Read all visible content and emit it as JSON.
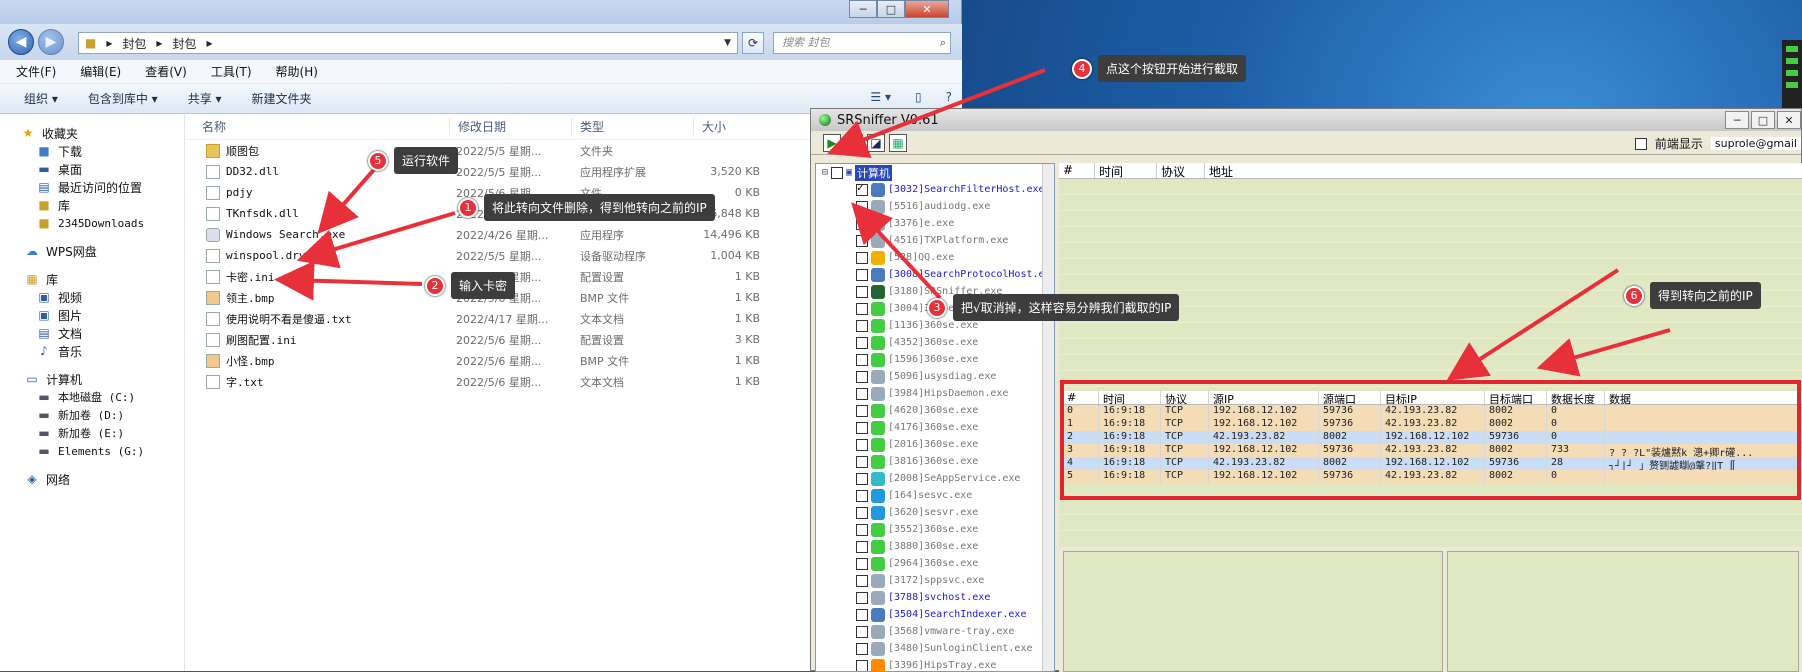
{
  "explorer": {
    "breadcrumb": [
      "封包",
      "封包"
    ],
    "search_placeholder": "搜索 封包",
    "menu": [
      "文件(F)",
      "编辑(E)",
      "查看(V)",
      "工具(T)",
      "帮助(H)"
    ],
    "toolbar": [
      "组织 ▾",
      "包含到库中 ▾",
      "共享 ▾",
      "新建文件夹"
    ],
    "nav": {
      "favorites": "收藏夹",
      "fav_items": [
        "下载",
        "桌面",
        "最近访问的位置",
        "库",
        "2345Downloads"
      ],
      "wps": "WPS网盘",
      "library": "库",
      "lib_items": [
        "视频",
        "图片",
        "文档",
        "音乐"
      ],
      "computer": "计算机",
      "drives": [
        "本地磁盘 (C:)",
        "新加卷 (D:)",
        "新加卷 (E:)",
        "Elements (G:)"
      ],
      "network": "网络"
    },
    "columns": [
      "名称",
      "修改日期",
      "类型",
      "大小"
    ],
    "files": [
      {
        "name": "顺图包",
        "date": "2022/5/5 星期...",
        "type": "文件夹",
        "size": "",
        "icon": "folder"
      },
      {
        "name": "DD32.dll",
        "date": "2022/5/5 星期...",
        "type": "应用程序扩展",
        "size": "3,520 KB",
        "icon": "file"
      },
      {
        "name": "pdjy",
        "date": "2022/5/6 星期...",
        "type": "文件",
        "size": "0 KB",
        "icon": "file"
      },
      {
        "name": "TKnfsdk.dll",
        "date": "2022/5/5 星期...",
        "type": "应用程序扩展",
        "size": "6,848 KB",
        "icon": "file"
      },
      {
        "name": "Windows Search.exe",
        "date": "2022/4/26 星期...",
        "type": "应用程序",
        "size": "14,496 KB",
        "icon": "exe"
      },
      {
        "name": "winspool.drv",
        "date": "2022/5/5 星期...",
        "type": "设备驱动程序",
        "size": "1,004 KB",
        "icon": "file"
      },
      {
        "name": "卡密.ini",
        "date": "2022/5/6 星期...",
        "type": "配置设置",
        "size": "1 KB",
        "icon": "file"
      },
      {
        "name": "领主.bmp",
        "date": "2022/5/6 星期...",
        "type": "BMP 文件",
        "size": "1 KB",
        "icon": "bmp"
      },
      {
        "name": "使用说明不看是傻逼.txt",
        "date": "2022/4/17 星期...",
        "type": "文本文档",
        "size": "1 KB",
        "icon": "file"
      },
      {
        "name": "刷图配置.ini",
        "date": "2022/5/6 星期...",
        "type": "配置设置",
        "size": "3 KB",
        "icon": "file"
      },
      {
        "name": "小怪.bmp",
        "date": "2022/5/6 星期...",
        "type": "BMP 文件",
        "size": "1 KB",
        "icon": "bmp"
      },
      {
        "name": "字.txt",
        "date": "2022/5/6 星期...",
        "type": "文本文档",
        "size": "1 KB",
        "icon": "file"
      }
    ]
  },
  "sniffer": {
    "title": "SRSniffer V0.61",
    "option_label": "前端显示",
    "user": "suprole@gmail",
    "tree_root": "计算机",
    "processes": [
      {
        "text": "[3032]SearchFilterHost.exe",
        "hl": true,
        "checked": true,
        "color": "#4a7bbf"
      },
      {
        "text": "[5516]audiodg.exe",
        "hl": false,
        "checked": false,
        "color": "#9ab"
      },
      {
        "text": "[3376]e.exe",
        "hl": false,
        "checked": false,
        "color": "#9ab"
      },
      {
        "text": "[4516]TXPlatform.exe",
        "hl": false,
        "checked": false,
        "color": "#9ab"
      },
      {
        "text": "[528]QQ.exe",
        "hl": false,
        "checked": false,
        "color": "#f0b000"
      },
      {
        "text": "[3008]SearchProtocolHost.e",
        "hl": true,
        "checked": false,
        "color": "#4a7bbf"
      },
      {
        "text": "[3180]SRSniffer.exe",
        "hl": false,
        "checked": false,
        "color": "#263"
      },
      {
        "text": "[3004]360se.exe",
        "hl": false,
        "checked": false,
        "color": "#4c4"
      },
      {
        "text": "[1136]360se.exe",
        "hl": false,
        "checked": false,
        "color": "#4c4"
      },
      {
        "text": "[4352]360se.exe",
        "hl": false,
        "checked": false,
        "color": "#4c4"
      },
      {
        "text": "[1596]360se.exe",
        "hl": false,
        "checked": false,
        "color": "#4c4"
      },
      {
        "text": "[5096]usysdiag.exe",
        "hl": false,
        "checked": false,
        "color": "#9ab"
      },
      {
        "text": "[3984]HipsDaemon.exe",
        "hl": false,
        "checked": false,
        "color": "#9ab"
      },
      {
        "text": "[4620]360se.exe",
        "hl": false,
        "checked": false,
        "color": "#4c4"
      },
      {
        "text": "[4176]360se.exe",
        "hl": false,
        "checked": false,
        "color": "#4c4"
      },
      {
        "text": "[2016]360se.exe",
        "hl": false,
        "checked": false,
        "color": "#4c4"
      },
      {
        "text": "[3816]360se.exe",
        "hl": false,
        "checked": false,
        "color": "#4c4"
      },
      {
        "text": "[2008]SeAppService.exe",
        "hl": false,
        "checked": false,
        "color": "#3bc"
      },
      {
        "text": "[164]sesvc.exe",
        "hl": false,
        "checked": false,
        "color": "#29d"
      },
      {
        "text": "[3620]sesvr.exe",
        "hl": false,
        "checked": false,
        "color": "#29d"
      },
      {
        "text": "[3552]360se.exe",
        "hl": false,
        "checked": false,
        "color": "#4c4"
      },
      {
        "text": "[3880]360se.exe",
        "hl": false,
        "checked": false,
        "color": "#4c4"
      },
      {
        "text": "[2964]360se.exe",
        "hl": false,
        "checked": false,
        "color": "#4c4"
      },
      {
        "text": "[3172]sppsvc.exe",
        "hl": false,
        "checked": false,
        "color": "#9ab"
      },
      {
        "text": "[3788]svchost.exe",
        "hl": true,
        "checked": false,
        "color": "#9ab"
      },
      {
        "text": "[3504]SearchIndexer.exe",
        "hl": true,
        "checked": false,
        "color": "#4a7bbf"
      },
      {
        "text": "[3568]vmware-tray.exe",
        "hl": false,
        "checked": false,
        "color": "#9ab"
      },
      {
        "text": "[3480]SunloginClient.exe",
        "hl": false,
        "checked": false,
        "color": "#9ab"
      },
      {
        "text": "[3396]HipsTray.exe",
        "hl": false,
        "checked": false,
        "color": "#f80"
      }
    ],
    "main_columns": [
      "#",
      "时间",
      "协议",
      "地址"
    ],
    "packet_columns": [
      "#",
      "时间",
      "协议",
      "源IP",
      "源端口",
      "目标IP",
      "目标端口",
      "数据长度",
      "数据"
    ],
    "packets": [
      {
        "idx": "0",
        "time": "16:9:18",
        "proto": "TCP",
        "src": "192.168.12.102",
        "sport": "59736",
        "dst": "42.193.23.82",
        "dport": "8002",
        "len": "0",
        "data": ""
      },
      {
        "idx": "1",
        "time": "16:9:18",
        "proto": "TCP",
        "src": "192.168.12.102",
        "sport": "59736",
        "dst": "42.193.23.82",
        "dport": "8002",
        "len": "0",
        "data": ""
      },
      {
        "idx": "2",
        "time": "16:9:18",
        "proto": "TCP",
        "src": "42.193.23.82",
        "sport": "8002",
        "dst": "192.168.12.102",
        "dport": "59736",
        "len": "0",
        "data": ""
      },
      {
        "idx": "3",
        "time": "16:9:18",
        "proto": "TCP",
        "src": "192.168.12.102",
        "sport": "59736",
        "dst": "42.193.23.82",
        "dport": "8002",
        "len": "733",
        "data": "? ? ?L\"装爐黙k 漗+卿r礶..."
      },
      {
        "idx": "4",
        "time": "16:9:18",
        "proto": "TCP",
        "src": "42.193.23.82",
        "sport": "8002",
        "dst": "192.168.12.102",
        "dport": "59736",
        "len": "28",
        "data": "┐┘|┘  」赘铡譃瞓@鞶?‖T ∬"
      },
      {
        "idx": "5",
        "time": "16:9:18",
        "proto": "TCP",
        "src": "192.168.12.102",
        "sport": "59736",
        "dst": "42.193.23.82",
        "dport": "8002",
        "len": "0",
        "data": ""
      }
    ]
  },
  "annotations": [
    {
      "num": "1",
      "text": "将此转向文件删除，得到他转向之前的IP"
    },
    {
      "num": "2",
      "text": "输入卡密"
    },
    {
      "num": "3",
      "text": "把√取消掉，这样容易分辨我们截取的IP"
    },
    {
      "num": "4",
      "text": "点这个按钮开始进行截取"
    },
    {
      "num": "5",
      "text": "运行软件"
    },
    {
      "num": "6",
      "text": "得到转向之前的IP"
    }
  ]
}
